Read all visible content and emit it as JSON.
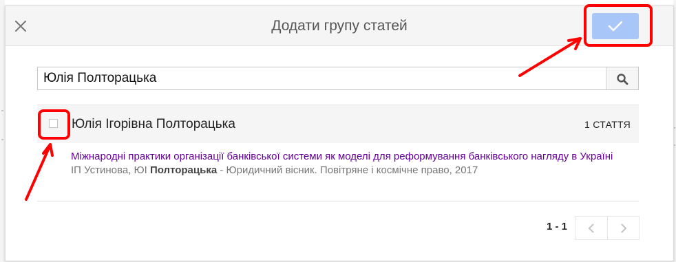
{
  "dialog": {
    "title": "Додати групу статей",
    "close_icon": "close-icon",
    "confirm_icon": "checkmark-icon"
  },
  "search": {
    "value": "Юлія Полторацька",
    "button_icon": "search-icon"
  },
  "group": {
    "name": "Юлія Ігорівна Полторацька",
    "count": "1 СТАТТЯ",
    "checked": false
  },
  "article": {
    "title": "Міжнародні практики організації банківської системи як моделі для реформування банківського нагляду в Україні",
    "authors_prefix": "ІП Устинова, ЮІ ",
    "authors_bold": "Полторацька",
    "source": " - Юридичний вісник. Повітряне і космічне право, 2017"
  },
  "pagination": {
    "range": "1 - 1",
    "prev_icon": "chevron-left-icon",
    "next_icon": "chevron-right-icon"
  },
  "colors": {
    "confirm_button": "#a9c6f8",
    "article_link": "#660099",
    "annotation": "#ff0000"
  }
}
